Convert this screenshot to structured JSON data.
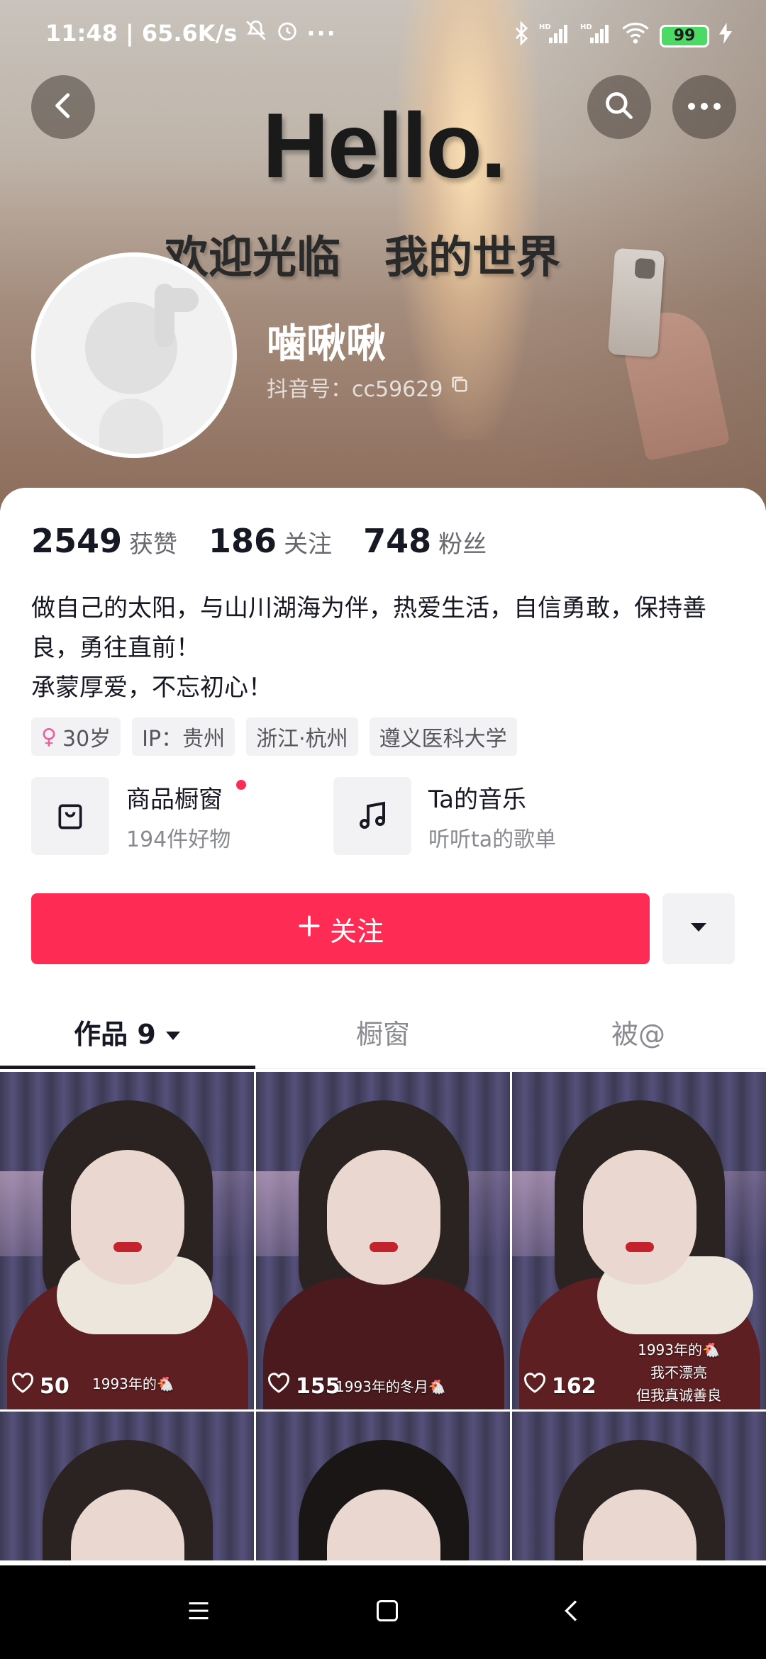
{
  "status_bar": {
    "time_network": "11:48 | 65.6K/s",
    "battery": "99",
    "signal_1": "HD",
    "signal_2": "HD"
  },
  "header": {
    "banner_text_hello": "Hello.",
    "banner_text_welcome": "欢迎光临　我的世界"
  },
  "profile": {
    "nickname": "噛啾啾",
    "douyin_id": "抖音号：cc59629"
  },
  "stats": [
    {
      "value": "2549",
      "label": "获赞"
    },
    {
      "value": "186",
      "label": "关注"
    },
    {
      "value": "748",
      "label": "粉丝"
    }
  ],
  "bio": {
    "line1": "做自己的太阳，与山川湖海为伴，热爱生活，自信勇敢，保持善良，勇往直前！",
    "line2": "承蒙厚爱，不忘初心！"
  },
  "tags": [
    {
      "label": "30岁",
      "icon": "female-icon"
    },
    {
      "label": "IP：贵州"
    },
    {
      "label": "浙江·杭州"
    },
    {
      "label": "遵义医科大学"
    }
  ],
  "services": {
    "shop_title": "商品橱窗",
    "shop_sub": "194件好物",
    "music_title": "Ta的音乐",
    "music_sub": "听听ta的歌单"
  },
  "actions": {
    "follow_label": "关注"
  },
  "tabs": [
    {
      "label": "作品 9",
      "active": true
    },
    {
      "label": "橱窗",
      "active": false
    },
    {
      "label": "被@",
      "active": false
    }
  ],
  "videos": [
    {
      "likes": "50",
      "caption": "1993年的🐔"
    },
    {
      "likes": "155",
      "caption": "1993年的冬月🐔"
    },
    {
      "likes": "162",
      "caption": "1993年的🐔\n我不漂亮\n但我真诚善良"
    },
    {
      "likes": "",
      "caption": ""
    },
    {
      "likes": "",
      "caption": ""
    },
    {
      "likes": "",
      "caption": ""
    }
  ],
  "colors": {
    "accent": "#fe2c55",
    "text_primary": "#161823",
    "text_secondary": "#68696e"
  }
}
